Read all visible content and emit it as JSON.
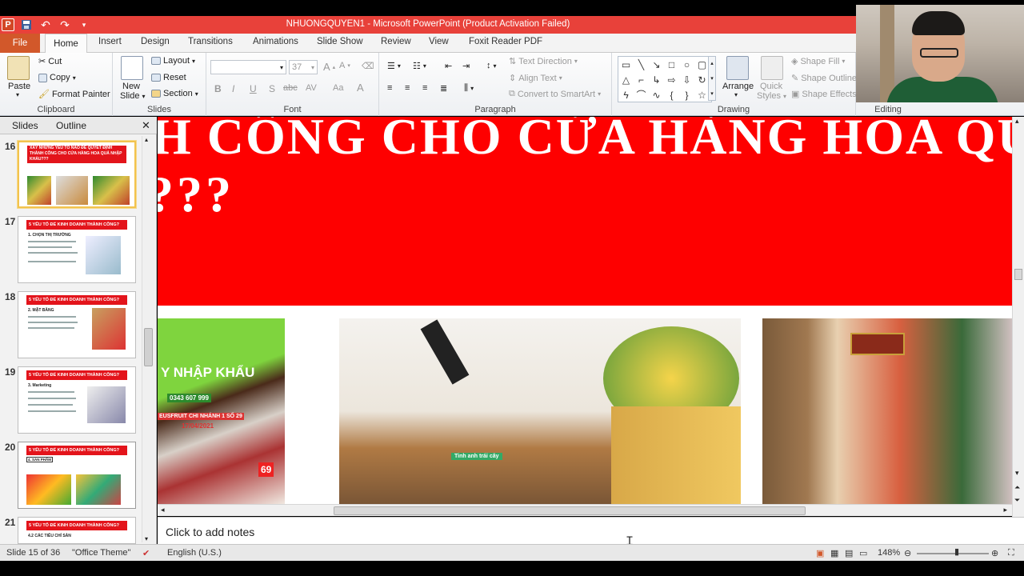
{
  "window": {
    "title": "NHUONGQUYEN1 - Microsoft PowerPoint (Product Activation Failed)"
  },
  "tabs": {
    "file": "File",
    "home": "Home",
    "items": [
      "Insert",
      "Design",
      "Transitions",
      "Animations",
      "Slide Show",
      "Review",
      "View",
      "Foxit Reader PDF"
    ]
  },
  "ribbon": {
    "clipboard": {
      "label": "Clipboard",
      "paste": "Paste",
      "cut": "Cut",
      "copy": "Copy",
      "format_painter": "Format Painter"
    },
    "slides": {
      "label": "Slides",
      "new_slide_1": "New",
      "new_slide_2": "Slide",
      "layout": "Layout",
      "reset": "Reset",
      "section": "Section"
    },
    "font": {
      "label": "Font",
      "font_name": "",
      "font_size": "37",
      "bold": "B",
      "italic": "I",
      "underline": "U",
      "shadow": "S",
      "strike": "abc",
      "spacing": "AV",
      "case": "Aa",
      "color": "A"
    },
    "paragraph": {
      "label": "Paragraph",
      "text_direction": "Text Direction",
      "align_text": "Align Text",
      "convert_smartart": "Convert to SmartArt"
    },
    "drawing": {
      "label": "Drawing",
      "arrange": "Arrange",
      "quick_styles_1": "Quick",
      "quick_styles_2": "Styles",
      "shape_fill": "Shape Fill",
      "shape_outline": "Shape Outline",
      "shape_effects": "Shape Effects"
    },
    "editing": {
      "label": "Editing"
    }
  },
  "left_panel": {
    "tabs": [
      "Slides",
      "Outline"
    ],
    "thumbnails": [
      {
        "num": "16",
        "heading": "XÂY NHỮNG YẾU TỐ NÀO ĐỂ QUYẾT ĐỊNH THÀNH CÔNG CHO CỬA HÀNG HOA QUẢ NHẬP KHẨU???",
        "selected": true
      },
      {
        "num": "17",
        "heading": "5 YẾU TỐ ĐỂ KINH DOANH THÀNH CÔNG?",
        "sub": "1. CHỌN THỊ TRƯỜNG",
        "selected": false
      },
      {
        "num": "18",
        "heading": "5 YẾU TỐ ĐỂ KINH DOANH THÀNH CÔNG?",
        "sub": "2. MẶT BẰNG",
        "selected": false
      },
      {
        "num": "19",
        "heading": "5 YẾU TỐ ĐỂ KINH DOANH THÀNH CÔNG?",
        "sub": "3. Marketing",
        "selected": false
      },
      {
        "num": "20",
        "heading": "5 YẾU TỐ ĐỂ KINH DOANH THÀNH CÔNG?",
        "sub": "4. SẢN PHẨM",
        "selected": false
      },
      {
        "num": "21",
        "heading": "5 YẾU TỐ ĐỂ KINH DOANH THÀNH CÔNG?",
        "sub": "4.2 CÁC TIÊU CHÍ SẢN",
        "selected": false
      }
    ]
  },
  "slide": {
    "title_line1": "H CÔNG CHO CỬA HÀNG HOA QU",
    "title_line2": "???",
    "photo1_text": [
      "Y NHẬP KHẨU",
      "0343 607 999",
      "EUSFRUIT CHI NHÁNH 1 SỐ 29",
      "17/04/2021",
      "69"
    ],
    "photo2_text": "Tinh anh trái cây"
  },
  "notes": {
    "placeholder": "Click to add notes"
  },
  "status": {
    "slide_info": "Slide 15 of 36",
    "theme": "\"Office Theme\"",
    "language": "English (U.S.)",
    "zoom": "148%"
  }
}
